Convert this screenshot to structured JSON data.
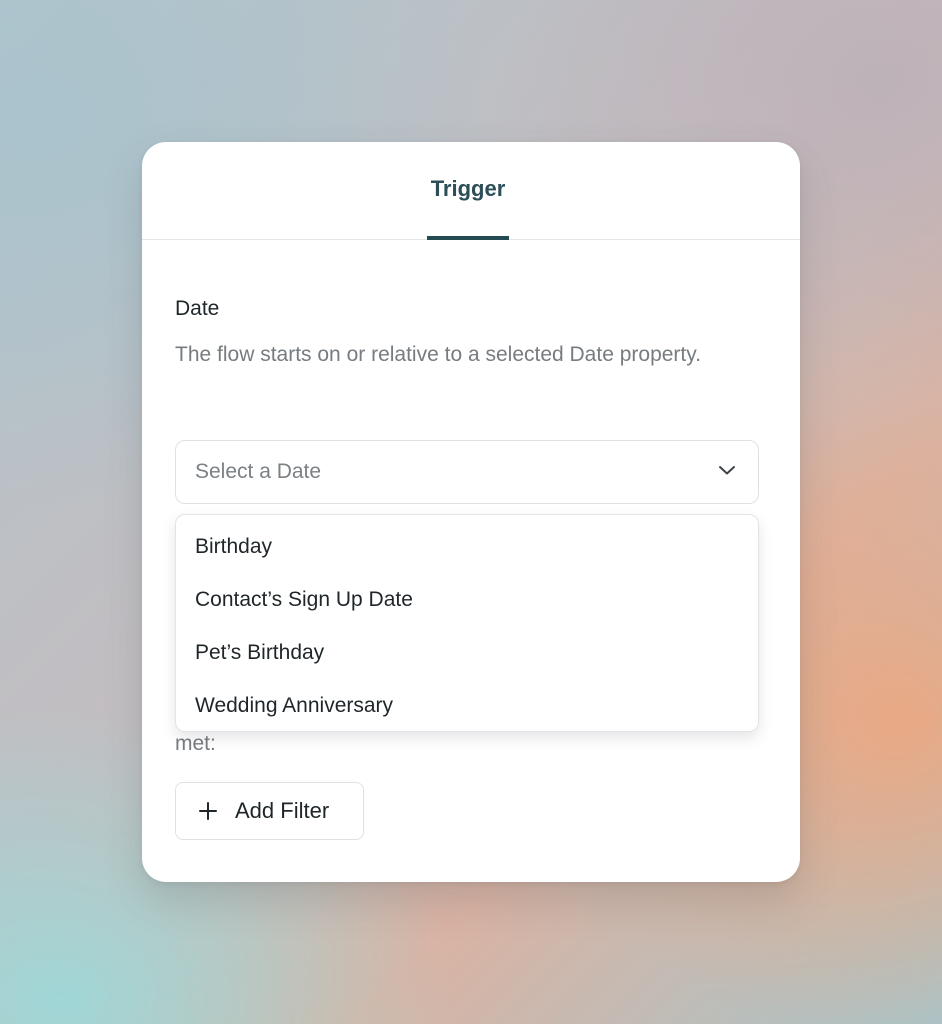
{
  "tabs": {
    "active_label": "Trigger"
  },
  "section": {
    "title": "Date",
    "description": "The flow starts on or relative to a selected Date property."
  },
  "select": {
    "placeholder": "Select a Date",
    "icon": "chevron-down-icon"
  },
  "dropdown": {
    "options": [
      "Birthday",
      "Contact’s Sign Up Date",
      "Pet’s Birthday",
      "Wedding Anniversary"
    ]
  },
  "filters": {
    "partial_text": "met:",
    "add_label": "Add Filter",
    "add_icon": "plus-icon"
  },
  "colors": {
    "accent": "#224b52",
    "tab_text": "#2c4f57",
    "muted_text": "#777c80",
    "border": "#dfe2e4"
  }
}
